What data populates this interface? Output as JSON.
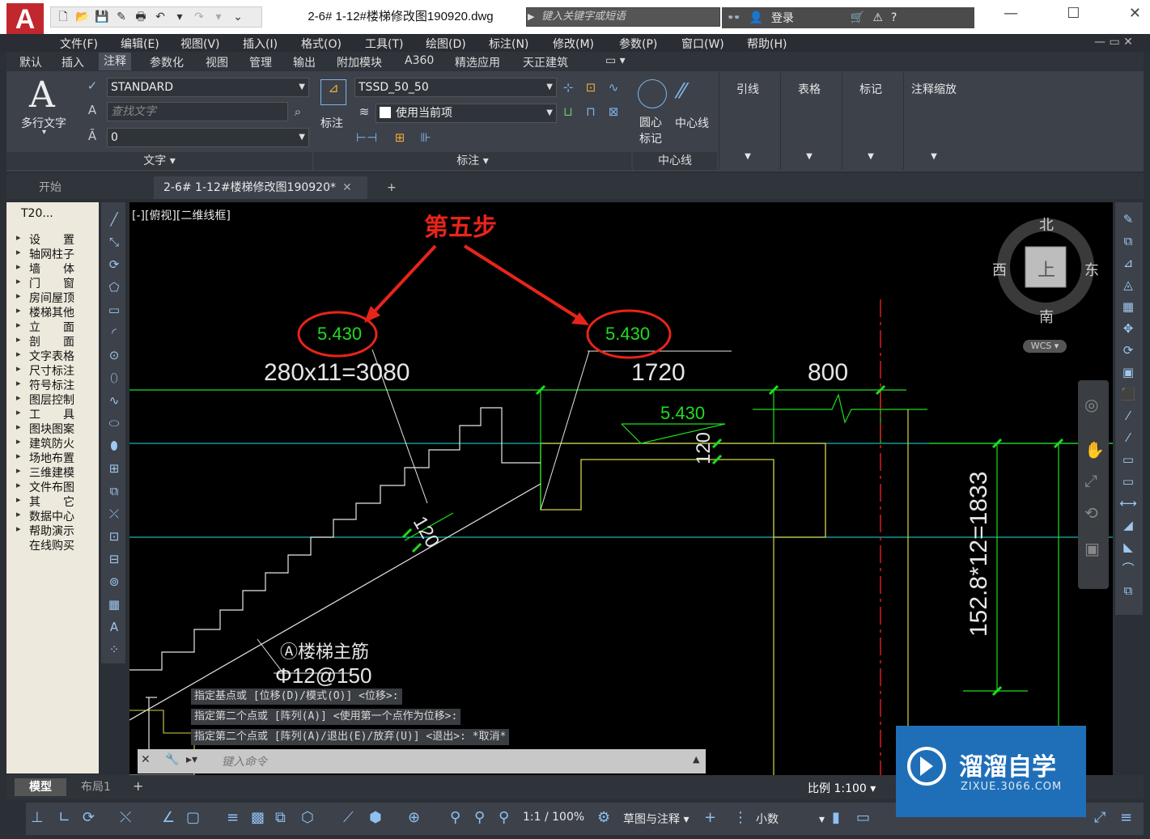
{
  "title_bar": {
    "logo": "A",
    "document_title": "2-6# 1-12#楼梯修改图190920.dwg",
    "search_placeholder": "键入关键字或短语",
    "login": "登录"
  },
  "menu": [
    "文件(F)",
    "编辑(E)",
    "视图(V)",
    "插入(I)",
    "格式(O)",
    "工具(T)",
    "绘图(D)",
    "标注(N)",
    "修改(M)",
    "参数(P)",
    "窗口(W)",
    "帮助(H)"
  ],
  "ribbon_tabs": [
    "默认",
    "插入",
    "注释",
    "参数化",
    "视图",
    "管理",
    "输出",
    "附加模块",
    "A360",
    "精选应用",
    "天正建筑"
  ],
  "ribbon_active_tab": "注释",
  "ribbon": {
    "text_panel": {
      "mtext_label": "多行文字",
      "style_value": "STANDARD",
      "find_placeholder": "查找文字",
      "height_value": "0",
      "footer": "文字"
    },
    "dim_panel": {
      "dim_label": "标注",
      "dim_style_value": "TSSD_50_50",
      "layer_value": "使用当前项",
      "footer": "标注"
    },
    "center_panel": {
      "center_mark_label": "圆心标记",
      "centerline_label": "中心线",
      "footer": "中心线"
    },
    "other_panels": [
      "引线",
      "表格",
      "标记",
      "注释缩放"
    ]
  },
  "file_tabs": [
    "开始",
    "2-6# 1-12#楼梯修改图190920*"
  ],
  "left_panel": {
    "title": "T20...",
    "items": [
      "设　　置",
      "轴网柱子",
      "墙　　体",
      "门　　窗",
      "房间屋顶",
      "楼梯其他",
      "立　　面",
      "剖　　面",
      "文字表格",
      "尺寸标注",
      "符号标注",
      "图层控制",
      "工　　具",
      "图块图案",
      "建筑防火",
      "场地布置",
      "三维建模",
      "文件布图",
      "其　　它",
      "数据中心",
      "帮助演示",
      "在线购买"
    ]
  },
  "viewport": {
    "label": "[-][俯视][二维线框]",
    "annotation_step": "第五步",
    "elev_left": "5.430",
    "elev_right": "5.430",
    "elev_small": "5.430",
    "dim_stairs": "280x11=3080",
    "dim_1720": "1720",
    "dim_800": "800",
    "dim_120a": "120",
    "dim_120b": "120",
    "dim_vertical": "152.8*12=1833",
    "rebar_label": "Ⓐ楼梯主筋",
    "rebar_spec": "Φ12@150",
    "viewcube": {
      "north": "北",
      "south": "南",
      "east": "东",
      "west": "西",
      "top": "上",
      "wcs": "WCS"
    }
  },
  "command_history": [
    "指定基点或 [位移(D)/模式(O)] <位移>:",
    "指定第二个点或 [阵列(A)] <使用第一个点作为位移>:",
    "指定第二个点或 [阵列(A)/退出(E)/放弃(U)] <退出>: *取消*"
  ],
  "command_placeholder": "键入命令",
  "layout_tabs": [
    "模型",
    "布局1"
  ],
  "status": {
    "scale": "比例 1:100",
    "anno_scale": "1:1 / 100%",
    "workspace": "草图与注释",
    "units": "小数"
  },
  "watermark": {
    "brand": "溜溜自学",
    "url": "ZIXUE.3066.COM"
  },
  "colors": {
    "annotation": "#e8241a",
    "cad_green": "#1fdd1f",
    "cad_white": "#e6e6e6",
    "cad_yellow": "#d4d44a",
    "cad_cyan": "#19b5b5",
    "cad_red": "#e82020"
  }
}
